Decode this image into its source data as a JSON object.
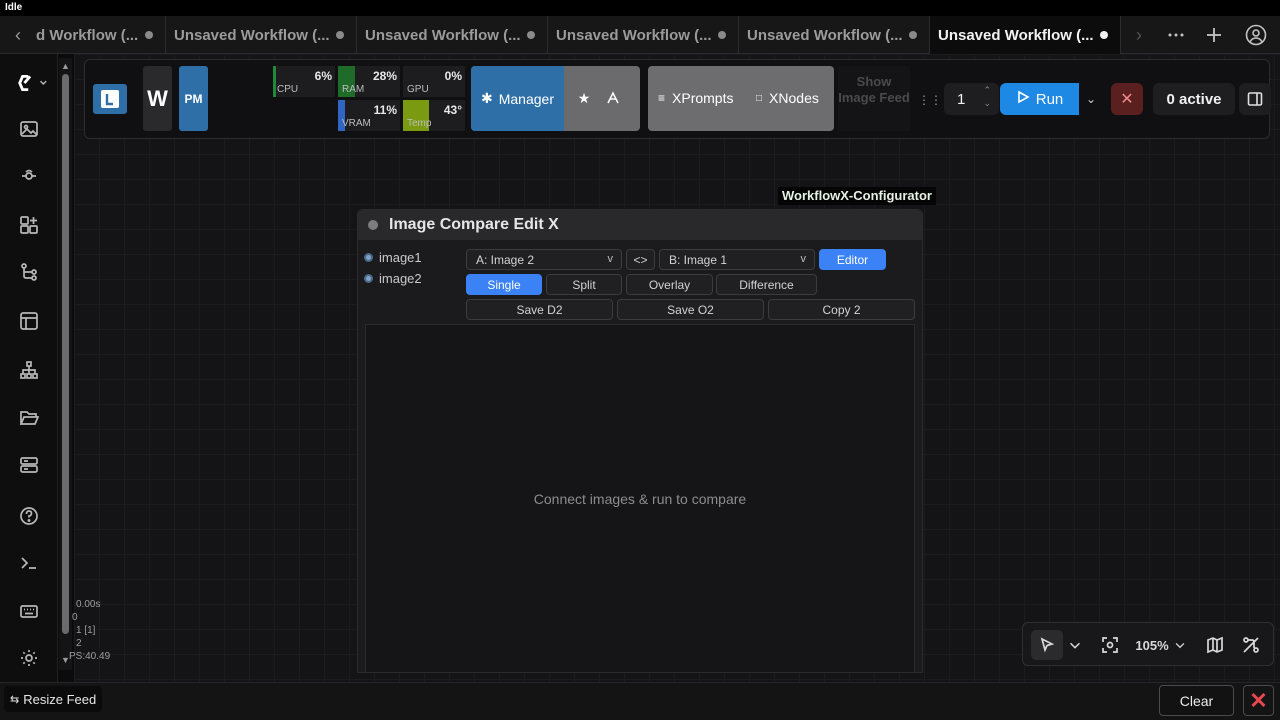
{
  "status": {
    "text": "Idle"
  },
  "tabs": [
    {
      "label": "d Workflow (...",
      "active": false
    },
    {
      "label": "Unsaved Workflow (...",
      "active": false
    },
    {
      "label": "Unsaved Workflow (...",
      "active": false
    },
    {
      "label": "Unsaved Workflow (...",
      "active": false
    },
    {
      "label": "Unsaved Workflow (...",
      "active": false
    },
    {
      "label": "Unsaved Workflow (...",
      "active": true
    }
  ],
  "toolbar": {
    "w_label": "W",
    "pm_label": "PM",
    "resources": [
      {
        "name": "CPU",
        "value": "6%",
        "color": "#1f8a3a"
      },
      {
        "name": "RAM",
        "value": "28%",
        "color": "#1f7a2e"
      },
      {
        "name": "GPU",
        "value": "0%",
        "color": "#2a2a2d"
      },
      {
        "name": "VRAM",
        "value": "11%",
        "color": "#2f66c4"
      },
      {
        "name": "Temp",
        "value": "43°",
        "color": "#7a9a12"
      }
    ],
    "manager_label": "Manager",
    "xprompts_label": "XPrompts",
    "xnodes_label": "XNodes",
    "show_feed_label": "Show Image Feed",
    "queue_count": "1",
    "run_label": "Run",
    "active_label": "0 active"
  },
  "node": {
    "tag": "WorkflowX-Configurator",
    "title": "Image Compare Edit X",
    "inputs": [
      "image1",
      "image2"
    ],
    "select_a": "A: Image 2",
    "swap_label": "<>",
    "select_b": "B: Image 1",
    "editor_label": "Editor",
    "modes": [
      "Single",
      "Split",
      "Overlay",
      "Difference"
    ],
    "actions": [
      "Save D2",
      "Save O2",
      "Copy 2"
    ],
    "placeholder": "Connect images & run to compare"
  },
  "stats": {
    "lines": [
      "0.00s",
      "0",
      "1 [1]",
      "2",
      "PS:40.49"
    ]
  },
  "zoom": {
    "value": "105%"
  },
  "bottom": {
    "resize_feed": "Resize Feed",
    "clear": "Clear"
  }
}
